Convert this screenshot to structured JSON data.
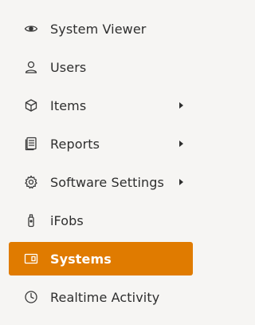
{
  "menu": {
    "accent_color": "#e07b00",
    "items": [
      {
        "label": "System Viewer",
        "icon": "eye-icon",
        "has_submenu": false,
        "active": false
      },
      {
        "label": "Users",
        "icon": "user-icon",
        "has_submenu": false,
        "active": false
      },
      {
        "label": "Items",
        "icon": "cube-icon",
        "has_submenu": true,
        "active": false
      },
      {
        "label": "Reports",
        "icon": "document-icon",
        "has_submenu": true,
        "active": false
      },
      {
        "label": "Software Settings",
        "icon": "gear-icon",
        "has_submenu": true,
        "active": false
      },
      {
        "label": "iFobs",
        "icon": "fob-icon",
        "has_submenu": false,
        "active": false
      },
      {
        "label": "Systems",
        "icon": "panel-icon",
        "has_submenu": false,
        "active": true
      },
      {
        "label": "Realtime Activity",
        "icon": "clock-icon",
        "has_submenu": false,
        "active": false
      }
    ]
  }
}
